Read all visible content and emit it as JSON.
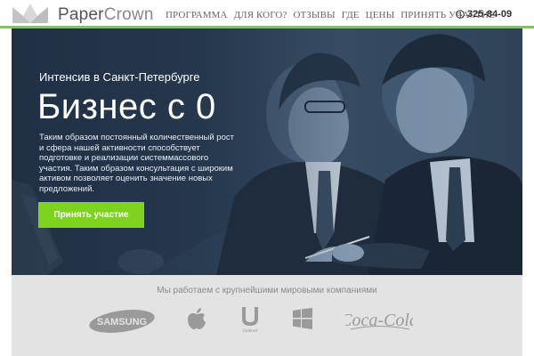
{
  "brand": {
    "name_part1": "Paper",
    "name_part2": "Crown"
  },
  "nav": {
    "items": [
      {
        "label": "ПРОГРАММА"
      },
      {
        "label": "ДЛЯ КОГО?"
      },
      {
        "label": "ОТЗЫВЫ"
      },
      {
        "label": "ГДЕ"
      },
      {
        "label": "ЦЕНЫ"
      },
      {
        "label": "ПРИНЯТЬ УЧАСТИЕ"
      }
    ],
    "phone": "325-84-09"
  },
  "hero": {
    "subtitle": "Интенсив в Санкт-Петербурге",
    "title": "Бизнес с 0",
    "text_lines": [
      "Таким образом постоянный количественный рост",
      "и сфера нашей активности способствует",
      "подготовке и реализации системмассового",
      "участия. Таким образом консультация с широким",
      "активом позволяет оценить значение новых",
      "предложений."
    ],
    "cta_label": "Принять участие"
  },
  "partners": {
    "title": "Мы работаем с крупнейшими мировыми компаниями",
    "logos": [
      {
        "name": "samsung-logo",
        "text": "SAMSUNG"
      },
      {
        "name": "apple-logo"
      },
      {
        "name": "unilever-logo",
        "text": "Unilever"
      },
      {
        "name": "windows-logo"
      },
      {
        "name": "coca-cola-logo",
        "text": "Coca-Cola"
      }
    ]
  },
  "colors": {
    "accent_green": "#7ed321",
    "hero_dark": "#2a3b52",
    "partners_bg": "#e3e3e3",
    "logo_gray": "#9a9a9a"
  }
}
